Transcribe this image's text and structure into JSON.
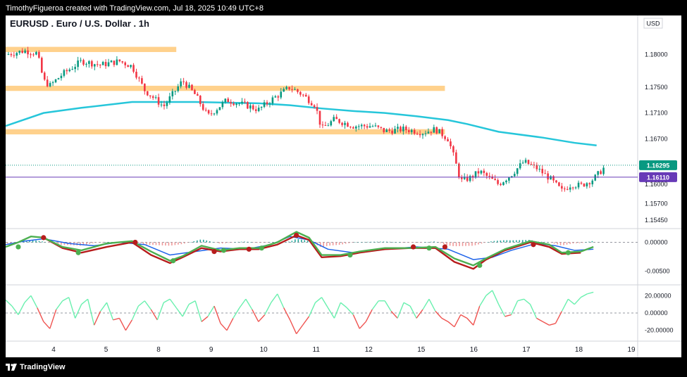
{
  "header": {
    "attribution": "TimothyFigueroa created with TradingView.com, Jul 18, 2025 10:49 UTC+8"
  },
  "footer": {
    "brand": "TradingView",
    "logo_icon": "tradingview-logo-icon"
  },
  "chart_data": {
    "type": "candlestick",
    "title": "EURUSD . Euro / U.S. Dollar . 1h",
    "currency": "USD",
    "x_tick_labels": [
      "4",
      "5",
      "8",
      "9",
      "10",
      "11",
      "12",
      "15",
      "16",
      "17",
      "18",
      "19"
    ],
    "price_axis": {
      "ticks": [
        "1.18000",
        "1.17500",
        "1.17100",
        "1.16700",
        "1.16000",
        "1.15700",
        "1.15450"
      ],
      "ylim": [
        1.1535,
        1.183
      ]
    },
    "price_labels": [
      {
        "value": 1.16295,
        "label": "1.16295",
        "color": "#089981",
        "style": "dotted"
      },
      {
        "value": 1.1611,
        "label": "1.16110",
        "color": "#673ab7",
        "style": "solid"
      }
    ],
    "zones": [
      {
        "low": 1.1804,
        "high": 1.1812,
        "from": 0,
        "to": 0.27,
        "color": "#ffcc80"
      },
      {
        "low": 1.1744,
        "high": 1.1752,
        "from": 0,
        "to": 0.695,
        "color": "#ffcc80"
      },
      {
        "low": 1.1677,
        "high": 1.1685,
        "from": 0,
        "to": 0.695,
        "color": "#ffcc80"
      }
    ],
    "ma_series": {
      "color": "#26c6da",
      "x": [
        0,
        0.06,
        0.12,
        0.2,
        0.3,
        0.4,
        0.45,
        0.5,
        0.55,
        0.6,
        0.65,
        0.7,
        0.73,
        0.78,
        0.85,
        0.9,
        0.935
      ],
      "y": [
        1.169,
        1.171,
        1.1718,
        1.1727,
        1.1727,
        1.1725,
        1.1722,
        1.1717,
        1.1713,
        1.171,
        1.1705,
        1.1699,
        1.1693,
        1.1681,
        1.1672,
        1.1664,
        1.166
      ]
    },
    "price_path": {
      "x": [
        0,
        0.03,
        0.05,
        0.06,
        0.07,
        0.09,
        0.12,
        0.15,
        0.18,
        0.2,
        0.22,
        0.25,
        0.28,
        0.3,
        0.32,
        0.35,
        0.38,
        0.4,
        0.42,
        0.45,
        0.47,
        0.49,
        0.5,
        0.52,
        0.55,
        0.58,
        0.6,
        0.63,
        0.66,
        0.68,
        0.7,
        0.71,
        0.72,
        0.735,
        0.75,
        0.78,
        0.8,
        0.82,
        0.83,
        0.84,
        0.86,
        0.88,
        0.895,
        0.91,
        0.93,
        0.95
      ],
      "y": [
        1.18,
        1.1806,
        1.1802,
        1.176,
        1.1752,
        1.177,
        1.179,
        1.1784,
        1.179,
        1.1782,
        1.1745,
        1.172,
        1.176,
        1.1738,
        1.1705,
        1.173,
        1.1722,
        1.1715,
        1.173,
        1.175,
        1.1738,
        1.1722,
        1.1685,
        1.17,
        1.169,
        1.169,
        1.1682,
        1.1685,
        1.168,
        1.1685,
        1.167,
        1.164,
        1.1605,
        1.161,
        1.162,
        1.16,
        1.1615,
        1.1635,
        1.163,
        1.1625,
        1.161,
        1.159,
        1.16,
        1.1598,
        1.1608,
        1.1629
      ]
    },
    "oscillator_1": {
      "ticks": [
        "0.00000",
        "-0.00500"
      ],
      "ylim": [
        -0.007,
        0.002
      ],
      "zero_line": 0,
      "fast_line": {
        "color": "#4caf50",
        "x": [
          0,
          0.02,
          0.04,
          0.06,
          0.09,
          0.12,
          0.16,
          0.2,
          0.23,
          0.26,
          0.28,
          0.31,
          0.34,
          0.37,
          0.4,
          0.43,
          0.46,
          0.48,
          0.5,
          0.53,
          0.56,
          0.6,
          0.64,
          0.68,
          0.71,
          0.74,
          0.76,
          0.79,
          0.83,
          0.86,
          0.88,
          0.91,
          0.93
        ],
        "y": [
          -0.0008,
          0.0,
          0.001,
          0.0008,
          -0.0008,
          -0.0014,
          -0.0002,
          0.0002,
          -0.0016,
          -0.0032,
          -0.0024,
          -0.0006,
          -0.0014,
          -0.001,
          -0.001,
          0.0,
          0.0018,
          0.0008,
          -0.0022,
          -0.0022,
          -0.0016,
          -0.001,
          -0.001,
          -0.0008,
          -0.0028,
          -0.004,
          -0.0028,
          -0.0012,
          0.0002,
          -0.0004,
          -0.0018,
          -0.0016,
          -0.0008
        ]
      },
      "slow_line": {
        "color": "#1e63e9",
        "x": [
          0,
          0.03,
          0.06,
          0.1,
          0.14,
          0.18,
          0.22,
          0.26,
          0.3,
          0.34,
          0.38,
          0.42,
          0.45,
          0.48,
          0.51,
          0.55,
          0.6,
          0.65,
          0.7,
          0.74,
          0.77,
          0.8,
          0.84,
          0.87,
          0.9,
          0.93
        ],
        "y": [
          -0.0004,
          0.0002,
          0.0006,
          -0.0002,
          -0.0006,
          0.0,
          -0.0004,
          -0.0022,
          -0.0016,
          -0.001,
          -0.0012,
          -0.0004,
          0.001,
          0.0004,
          -0.0012,
          -0.0018,
          -0.0012,
          -0.0008,
          -0.0012,
          -0.003,
          -0.0026,
          -0.0014,
          -0.0002,
          -0.0006,
          -0.0014,
          -0.0012
        ]
      },
      "signal_line": {
        "color": "#b71c1c",
        "x": [
          0.06,
          0.09,
          0.12,
          0.16,
          0.2,
          0.23,
          0.26,
          0.28,
          0.31,
          0.34,
          0.37,
          0.4,
          0.43,
          0.46,
          0.48,
          0.5,
          0.53,
          0.56,
          0.6,
          0.64,
          0.68,
          0.71,
          0.74,
          0.76,
          0.79,
          0.83,
          0.86,
          0.88,
          0.91
        ],
        "y": [
          0.0008,
          -0.001,
          -0.0018,
          -0.0008,
          0.0,
          -0.0022,
          -0.0036,
          -0.0026,
          -0.001,
          -0.0016,
          -0.0012,
          -0.0012,
          -0.0004,
          0.0012,
          0.0004,
          -0.0026,
          -0.0024,
          -0.0018,
          -0.0012,
          -0.001,
          -0.001,
          -0.0034,
          -0.0046,
          -0.003,
          -0.0014,
          0.0,
          -0.0008,
          -0.002,
          -0.0018
        ]
      },
      "cross_points": [
        {
          "x": 0.02,
          "y": -0.0008,
          "color": "#4caf50"
        },
        {
          "x": 0.06,
          "y": 0.0008,
          "color": "#b71c1c"
        },
        {
          "x": 0.115,
          "y": -0.0018,
          "color": "#4caf50"
        },
        {
          "x": 0.205,
          "y": 0.0,
          "color": "#b71c1c"
        },
        {
          "x": 0.265,
          "y": -0.0032,
          "color": "#4caf50"
        },
        {
          "x": 0.33,
          "y": -0.0016,
          "color": "#b71c1c"
        },
        {
          "x": 0.345,
          "y": -0.0014,
          "color": "#4caf50"
        },
        {
          "x": 0.385,
          "y": -0.0012,
          "color": "#b71c1c"
        },
        {
          "x": 0.405,
          "y": -0.001,
          "color": "#4caf50"
        },
        {
          "x": 0.46,
          "y": 0.0012,
          "color": "#b71c1c"
        },
        {
          "x": 0.545,
          "y": -0.0022,
          "color": "#4caf50"
        },
        {
          "x": 0.645,
          "y": -0.0008,
          "color": "#b71c1c"
        },
        {
          "x": 0.67,
          "y": -0.001,
          "color": "#4caf50"
        },
        {
          "x": 0.695,
          "y": -0.0008,
          "color": "#b71c1c"
        },
        {
          "x": 0.75,
          "y": -0.004,
          "color": "#4caf50"
        },
        {
          "x": 0.835,
          "y": -0.0004,
          "color": "#b71c1c"
        },
        {
          "x": 0.89,
          "y": -0.0018,
          "color": "#4caf50"
        }
      ]
    },
    "oscillator_2": {
      "ticks": [
        "20.00000",
        "0.00000",
        "-20.00000"
      ],
      "ylim": [
        -30,
        30
      ],
      "zero_line": 0,
      "line_colors": {
        "positive": "#69f0ae",
        "negative": "#ef5350"
      },
      "x": [
        0,
        0.01,
        0.02,
        0.03,
        0.04,
        0.05,
        0.06,
        0.07,
        0.08,
        0.09,
        0.1,
        0.11,
        0.12,
        0.13,
        0.14,
        0.15,
        0.16,
        0.17,
        0.18,
        0.19,
        0.2,
        0.21,
        0.22,
        0.23,
        0.24,
        0.25,
        0.26,
        0.27,
        0.28,
        0.29,
        0.3,
        0.31,
        0.32,
        0.33,
        0.34,
        0.35,
        0.36,
        0.37,
        0.38,
        0.39,
        0.4,
        0.41,
        0.42,
        0.43,
        0.44,
        0.45,
        0.46,
        0.47,
        0.48,
        0.49,
        0.5,
        0.51,
        0.52,
        0.53,
        0.54,
        0.55,
        0.56,
        0.57,
        0.58,
        0.59,
        0.6,
        0.61,
        0.62,
        0.63,
        0.64,
        0.65,
        0.66,
        0.67,
        0.68,
        0.69,
        0.7,
        0.71,
        0.72,
        0.73,
        0.74,
        0.75,
        0.76,
        0.77,
        0.78,
        0.79,
        0.8,
        0.81,
        0.82,
        0.83,
        0.84,
        0.85,
        0.86,
        0.87,
        0.88,
        0.89,
        0.9,
        0.91,
        0.92,
        0.93
      ],
      "y": [
        15,
        8,
        -2,
        12,
        20,
        6,
        -10,
        -18,
        4,
        14,
        18,
        -6,
        10,
        16,
        -14,
        2,
        12,
        -8,
        -6,
        -20,
        -8,
        8,
        14,
        4,
        -8,
        12,
        16,
        6,
        -4,
        10,
        14,
        -10,
        -4,
        8,
        -12,
        -20,
        -6,
        6,
        16,
        4,
        -10,
        -2,
        12,
        22,
        6,
        -8,
        -24,
        -14,
        -4,
        12,
        18,
        6,
        -6,
        12,
        6,
        -2,
        -18,
        -10,
        4,
        14,
        14,
        2,
        -6,
        12,
        8,
        -6,
        4,
        16,
        2,
        -6,
        -10,
        -16,
        -2,
        -6,
        -14,
        8,
        20,
        26,
        10,
        -4,
        -2,
        14,
        16,
        10,
        -6,
        -10,
        -14,
        -12,
        2,
        16,
        10,
        18,
        22,
        24
      ]
    }
  }
}
